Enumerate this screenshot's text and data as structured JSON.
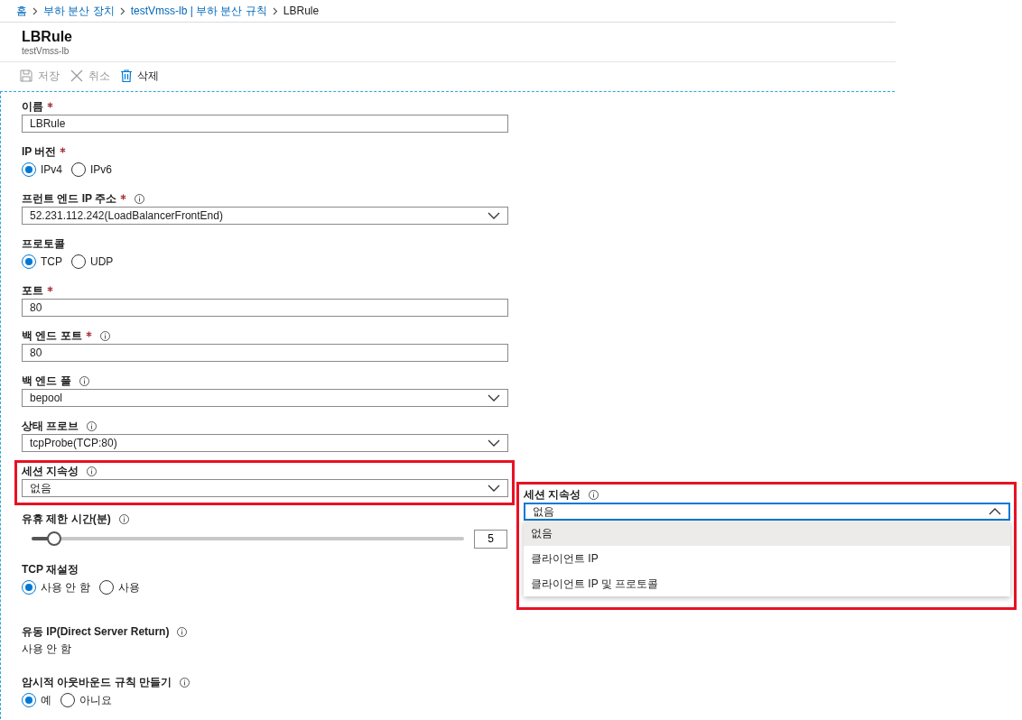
{
  "breadcrumb": [
    {
      "label": "홈",
      "link": true
    },
    {
      "label": "부하 분산 장치",
      "link": true
    },
    {
      "label": "testVmss-lb | 부하 분산 규칙",
      "link": true
    },
    {
      "label": "LBRule",
      "link": false
    }
  ],
  "header": {
    "title": "LBRule",
    "subtitle": "testVmss-lb"
  },
  "toolbar": [
    {
      "label": "저장",
      "disabled": true
    },
    {
      "label": "취소",
      "disabled": true
    },
    {
      "label": "삭제",
      "disabled": false
    }
  ],
  "fields": [
    {
      "kind": "text",
      "label": "이름",
      "required": true,
      "info": false,
      "value": "LBRule"
    },
    {
      "kind": "radio",
      "label": "IP 버전",
      "required": true,
      "info": false,
      "options": [
        {
          "label": "IPv4",
          "selected": true
        },
        {
          "label": "IPv6",
          "selected": false
        }
      ]
    },
    {
      "kind": "select",
      "label": "프런트 엔드 IP 주소",
      "required": true,
      "info": true,
      "value": "52.231.112.242(LoadBalancerFrontEnd)"
    },
    {
      "kind": "radio",
      "label": "프로토콜",
      "required": false,
      "info": false,
      "options": [
        {
          "label": "TCP",
          "selected": true
        },
        {
          "label": "UDP",
          "selected": false
        }
      ]
    },
    {
      "kind": "text",
      "label": "포트",
      "required": true,
      "info": false,
      "value": "80"
    },
    {
      "kind": "text",
      "label": "백 엔드 포트",
      "required": true,
      "info": true,
      "value": "80"
    },
    {
      "kind": "select",
      "label": "백 엔드 풀",
      "required": false,
      "info": true,
      "value": "bepool"
    },
    {
      "kind": "select",
      "label": "상태 프로브",
      "required": false,
      "info": true,
      "value": "tcpProbe(TCP:80)"
    },
    {
      "kind": "select",
      "label": "세션 지속성",
      "required": false,
      "info": true,
      "value": "없음",
      "highlighted": true
    },
    {
      "kind": "slider",
      "label": "유휴 제한 시간(분)",
      "required": false,
      "info": true,
      "level": 0.04,
      "value": "5"
    },
    {
      "kind": "radio",
      "label": "TCP 재설정",
      "required": false,
      "info": false,
      "options": [
        {
          "label": "사용 안 함",
          "selected": true
        },
        {
          "label": "사용",
          "selected": false
        }
      ]
    },
    {
      "kind": "static",
      "label": "유동 IP(Direct Server Return)",
      "required": false,
      "info": true,
      "value": "사용 안 함"
    },
    {
      "kind": "radio",
      "label": "암시적 아웃바운드 규칙 만들기",
      "required": false,
      "info": true,
      "options": [
        {
          "label": "예",
          "selected": true
        },
        {
          "label": "아니요",
          "selected": false
        }
      ]
    }
  ],
  "callout": {
    "label": "세션 지속성",
    "info": true,
    "value": "없음",
    "expanded": true,
    "options": [
      {
        "label": "없음",
        "selected": true
      },
      {
        "label": "클라이언트 IP",
        "selected": false
      },
      {
        "label": "클라이언트 IP 및 프로토콜",
        "selected": false
      }
    ]
  }
}
